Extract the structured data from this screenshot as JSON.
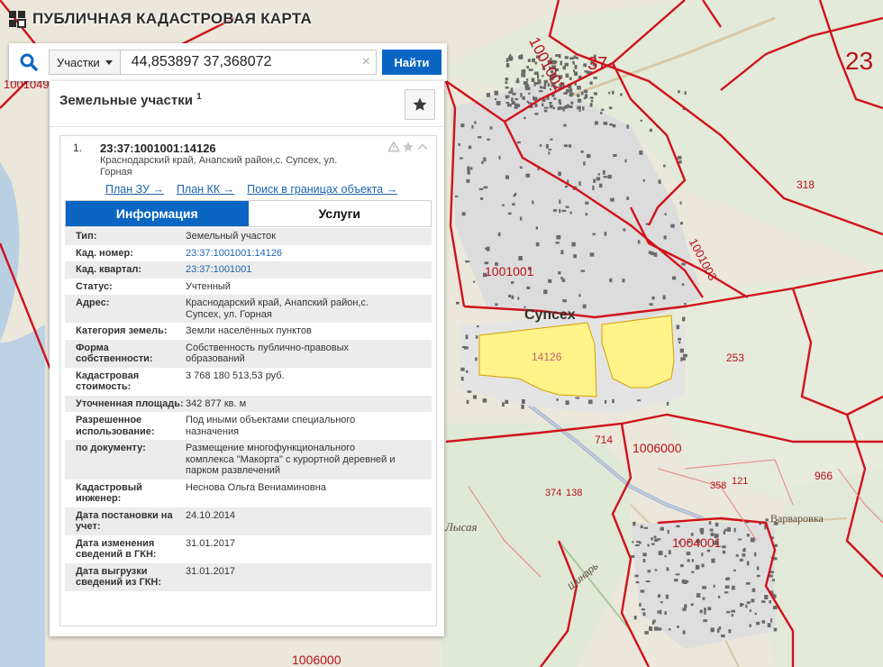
{
  "header": {
    "title": "ПУБЛИЧНАЯ КАДАСТРОВАЯ КАРТА",
    "logo_icon": "pkk-logo-icon"
  },
  "search": {
    "type_label": "Участки",
    "query": "44,853897 37,368072",
    "clear_glyph": "×",
    "find_label": "Найти"
  },
  "panel": {
    "title": "Земельные участки",
    "count": "1",
    "result": {
      "index": "1.",
      "cad_number": "23:37:1001001:14126",
      "address": "Краснодарский край, Анапский район,с. Супсех, ул. Горная",
      "links": [
        {
          "label": "План ЗУ →"
        },
        {
          "label": "План КК →"
        },
        {
          "label": "Поиск в границах объекта →"
        }
      ],
      "tabs": [
        {
          "label": "Информация",
          "active": true
        },
        {
          "label": "Услуги",
          "active": false
        }
      ],
      "info": [
        {
          "key": "Тип:",
          "value": "Земельный участок",
          "link": false
        },
        {
          "key": "Кад. номер:",
          "value": "23:37:1001001:14126",
          "link": true
        },
        {
          "key": "Кад. квартал:",
          "value": "23:37:1001001",
          "link": true
        },
        {
          "key": "Статус:",
          "value": "Учтенный",
          "link": false
        },
        {
          "key": "Адрес:",
          "value": "Краснодарский край, Анапский район,с. Супсех, ул. Горная",
          "link": false
        },
        {
          "key": "Категория земель:",
          "value": "Земли населённых пунктов",
          "link": false
        },
        {
          "key": "Форма собственности:",
          "value": "Собственность публично-правовых образований",
          "link": false
        },
        {
          "key": "Кадастровая стоимость:",
          "value": "3 768 180 513,53 руб.",
          "link": false
        },
        {
          "key": "Уточненная площадь:",
          "value": "342 877 кв. м",
          "link": false
        },
        {
          "key": "Разрешенное использование:",
          "value": "Под иными объектами специального назначения",
          "link": false
        },
        {
          "key": "по документу:",
          "value": "Размещение многофункционального комплекса \"Макорта\" с курортной деревней и парком развлечений",
          "link": false
        },
        {
          "key": "Кадастровый инженер:",
          "value": "Неснова Ольга Вениаминовна",
          "link": false
        },
        {
          "key": "Дата постановки на учет:",
          "value": "24.10.2014",
          "link": false
        },
        {
          "key": "Дата изменения сведений в ГКН:",
          "value": "31.01.2017",
          "link": false
        },
        {
          "key": "Дата выгрузки сведений из ГКН:",
          "value": "31.01.2017",
          "link": false
        }
      ]
    }
  },
  "map_labels": {
    "q1001002": "1001002",
    "n37": "37",
    "n23": "23",
    "q1001003": "1001003",
    "q1001001": "1001001",
    "supseh": "Супсех",
    "p14126": "14126",
    "n318": "318",
    "n253": "253",
    "n714": "714",
    "q1006000": "1006000",
    "n966": "966",
    "n358": "358",
    "n121": "121",
    "n374": "374",
    "n138": "138",
    "varvarovka": "Варваровка",
    "q1004001": "1004001",
    "lysaya": "Лысая",
    "q1006000b": "1006000",
    "q1001049": "1001049",
    "shinar": "Шинарь"
  },
  "colors": {
    "accent": "#0b66c3",
    "boundary": "#d0121b",
    "parcel_fill": "#fff38a",
    "link": "#1b63ad"
  }
}
